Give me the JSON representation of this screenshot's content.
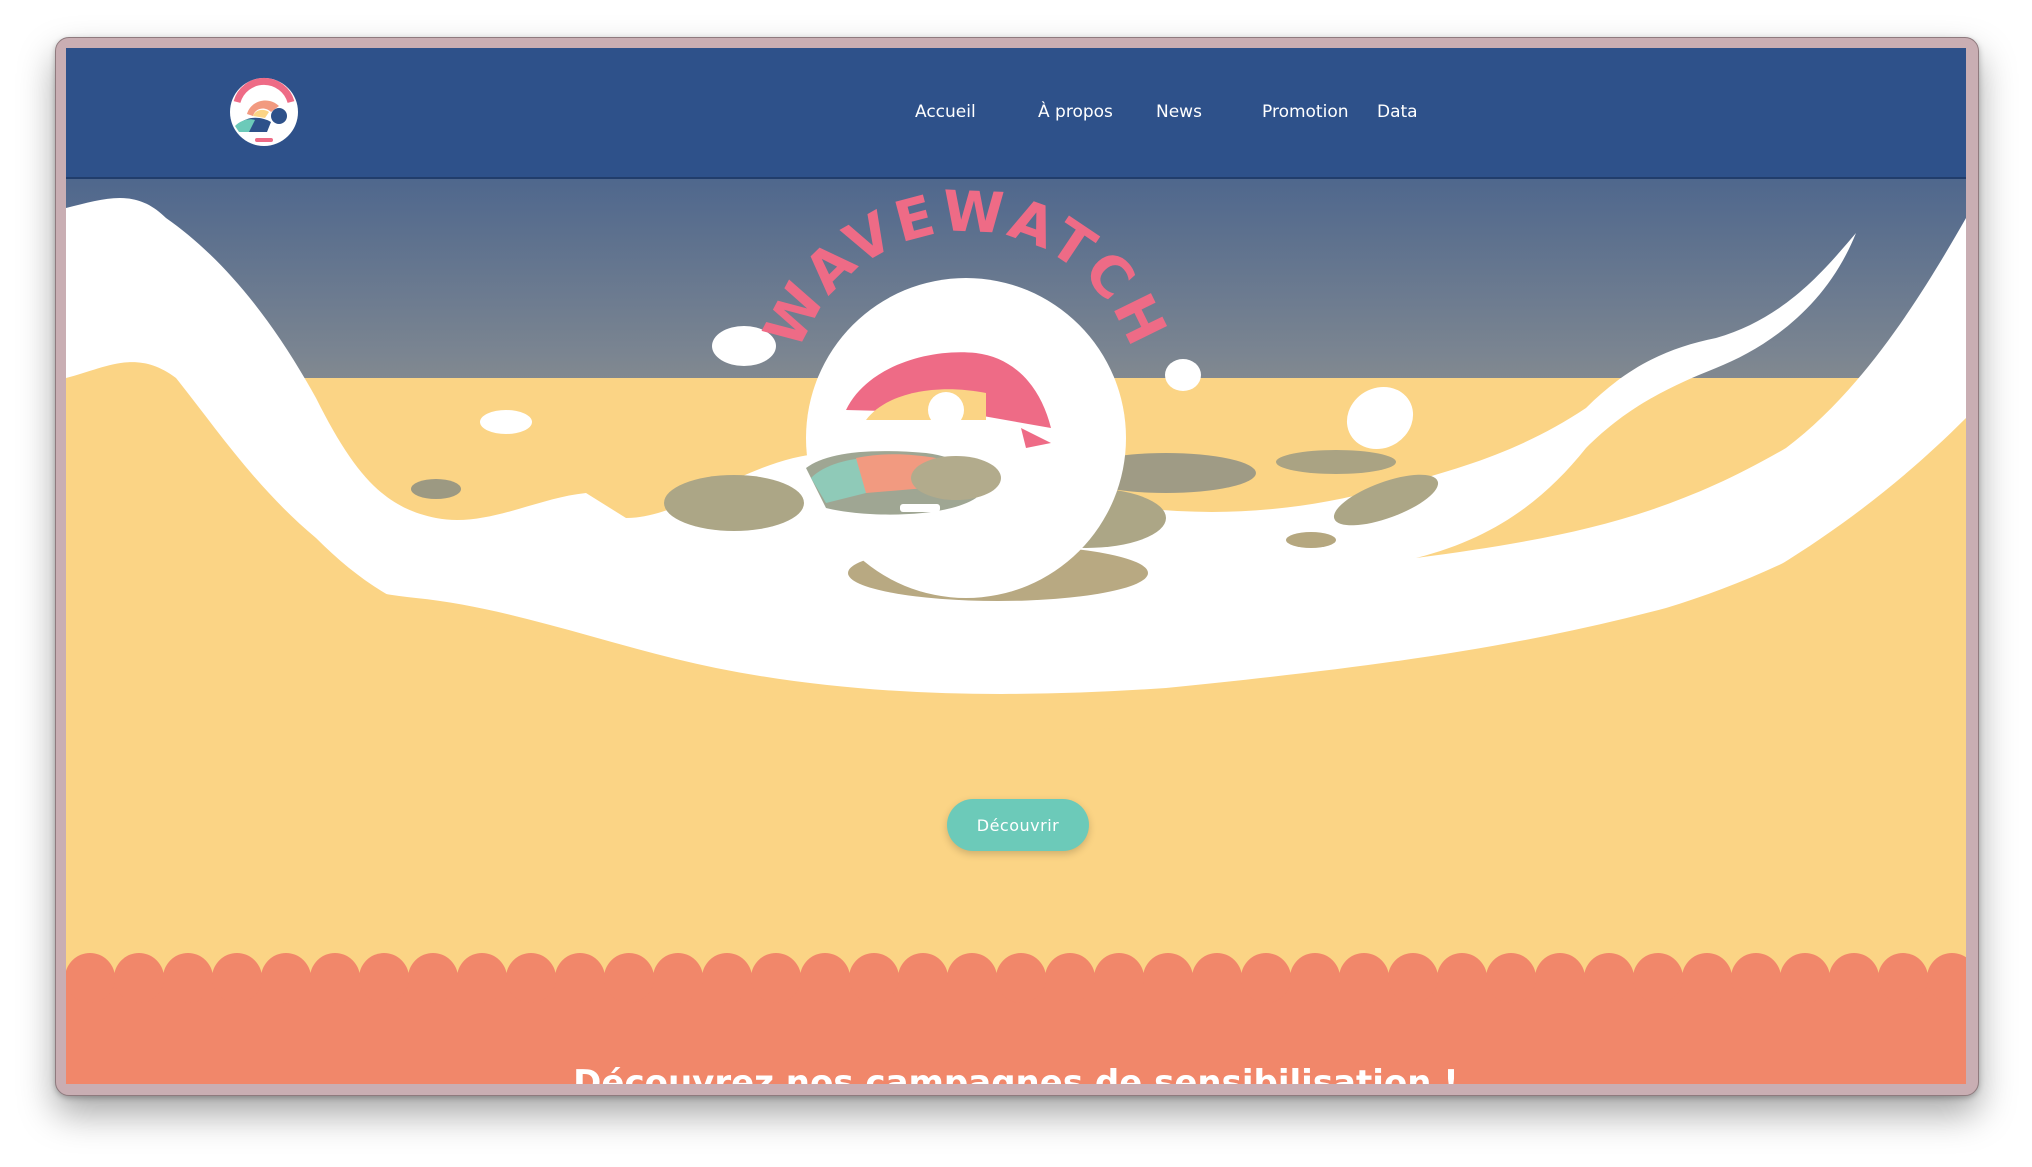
{
  "brand": {
    "name": "WAVEWATCH",
    "colors": {
      "navbar": "#2e518a",
      "sand": "#fbd485",
      "coral": "#f1876a",
      "mint": "#6ccab9",
      "pink": "#ee6b86"
    }
  },
  "nav": {
    "items": [
      {
        "label": "Accueil"
      },
      {
        "label": "À propos"
      },
      {
        "label": "News"
      },
      {
        "label": "Promotion"
      },
      {
        "label": "Data"
      }
    ]
  },
  "hero": {
    "cta_label": "Découvrir"
  },
  "section": {
    "title": "Découvrez nos campagnes de sensibilisation !"
  }
}
